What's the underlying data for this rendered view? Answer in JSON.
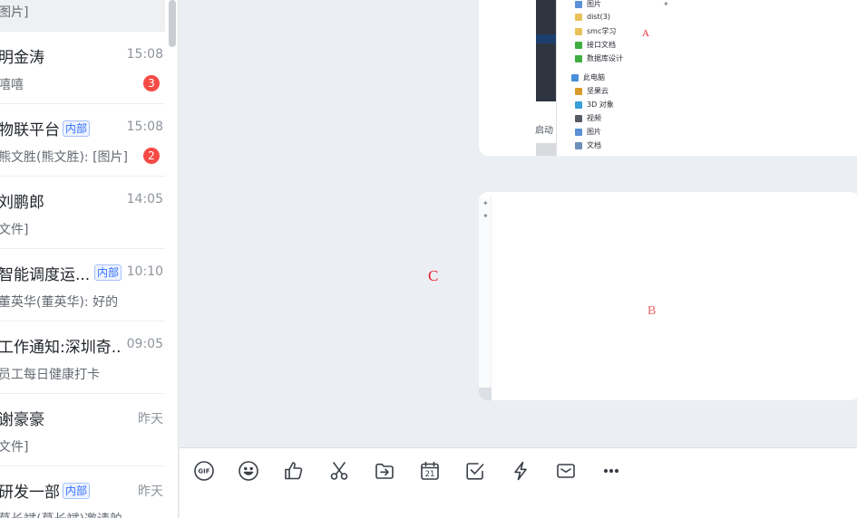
{
  "conversations": [
    {
      "name": "",
      "time": "",
      "preview": "图片]",
      "tag": "",
      "badge": ""
    },
    {
      "name": "明金涛",
      "time": "15:08",
      "preview": "嘻嘻",
      "tag": "",
      "badge": "3"
    },
    {
      "name": "物联平台",
      "time": "15:08",
      "preview": "熊文胜(熊文胜): [图片]",
      "tag": "内部",
      "badge": "2"
    },
    {
      "name": "刘鹏郎",
      "time": "14:05",
      "preview": "文件]",
      "tag": "",
      "badge": ""
    },
    {
      "name": "智能调度运...",
      "time": "10:10",
      "preview": "董英华(董英华): 好的",
      "tag": "内部",
      "badge": ""
    },
    {
      "name": "工作通知:深圳奇...",
      "time": "09:05",
      "preview": "员工每日健康打卡",
      "tag": "",
      "badge": ""
    },
    {
      "name": "谢豪豪",
      "time": "昨天",
      "preview": "文件]",
      "tag": "",
      "badge": ""
    },
    {
      "name": "研发一部",
      "time": "昨天",
      "preview": "葛长斌(葛长斌)邀请舶",
      "tag": "内部",
      "badge": ""
    }
  ],
  "screenshot_explorer": {
    "items": [
      {
        "label": "图片",
        "icon": "picture-icon",
        "color": "#5b8fd6"
      },
      {
        "label": "dist(3)",
        "icon": "folder-icon",
        "color": "#e8c15a"
      },
      {
        "label": "smc学习",
        "icon": "folder-icon",
        "color": "#e8c15a"
      },
      {
        "label": "接口文档",
        "icon": "refresh-folder-icon",
        "color": "#3fae3f"
      },
      {
        "label": "数据库设计",
        "icon": "refresh-folder-icon",
        "color": "#3fae3f"
      },
      {
        "label": "此电脑",
        "icon": "computer-icon",
        "color": "#4a90d9"
      },
      {
        "label": "坚果云",
        "icon": "nut-cloud-icon",
        "color": "#d99a2b"
      },
      {
        "label": "3D 对象",
        "icon": "cube-icon",
        "color": "#3aa0d8"
      },
      {
        "label": "视频",
        "icon": "video-icon",
        "color": "#555a63"
      },
      {
        "label": "图片",
        "icon": "picture-icon",
        "color": "#5b8fd6"
      },
      {
        "label": "文档",
        "icon": "document-icon",
        "color": "#6d8fb8"
      }
    ],
    "startup_label": "启动",
    "annotation_a": "A"
  },
  "annotations": {
    "b": "B",
    "c": "C"
  },
  "toolbar": {
    "items": [
      {
        "name": "gif-button",
        "icon": "gif-icon",
        "gif_text": "GIF"
      },
      {
        "name": "emoji-button",
        "icon": "smiley-icon"
      },
      {
        "name": "like-button",
        "icon": "thumbs-up-icon"
      },
      {
        "name": "screenshot-button",
        "icon": "scissors-icon"
      },
      {
        "name": "send-file-button",
        "icon": "folder-arrow-icon"
      },
      {
        "name": "calendar-button",
        "icon": "calendar-icon",
        "calendar_day": "21"
      },
      {
        "name": "task-button",
        "icon": "checkbox-icon"
      },
      {
        "name": "quick-action-button",
        "icon": "lightning-icon"
      },
      {
        "name": "mail-button",
        "icon": "envelope-icon"
      },
      {
        "name": "more-button",
        "icon": "more-icon"
      }
    ]
  }
}
